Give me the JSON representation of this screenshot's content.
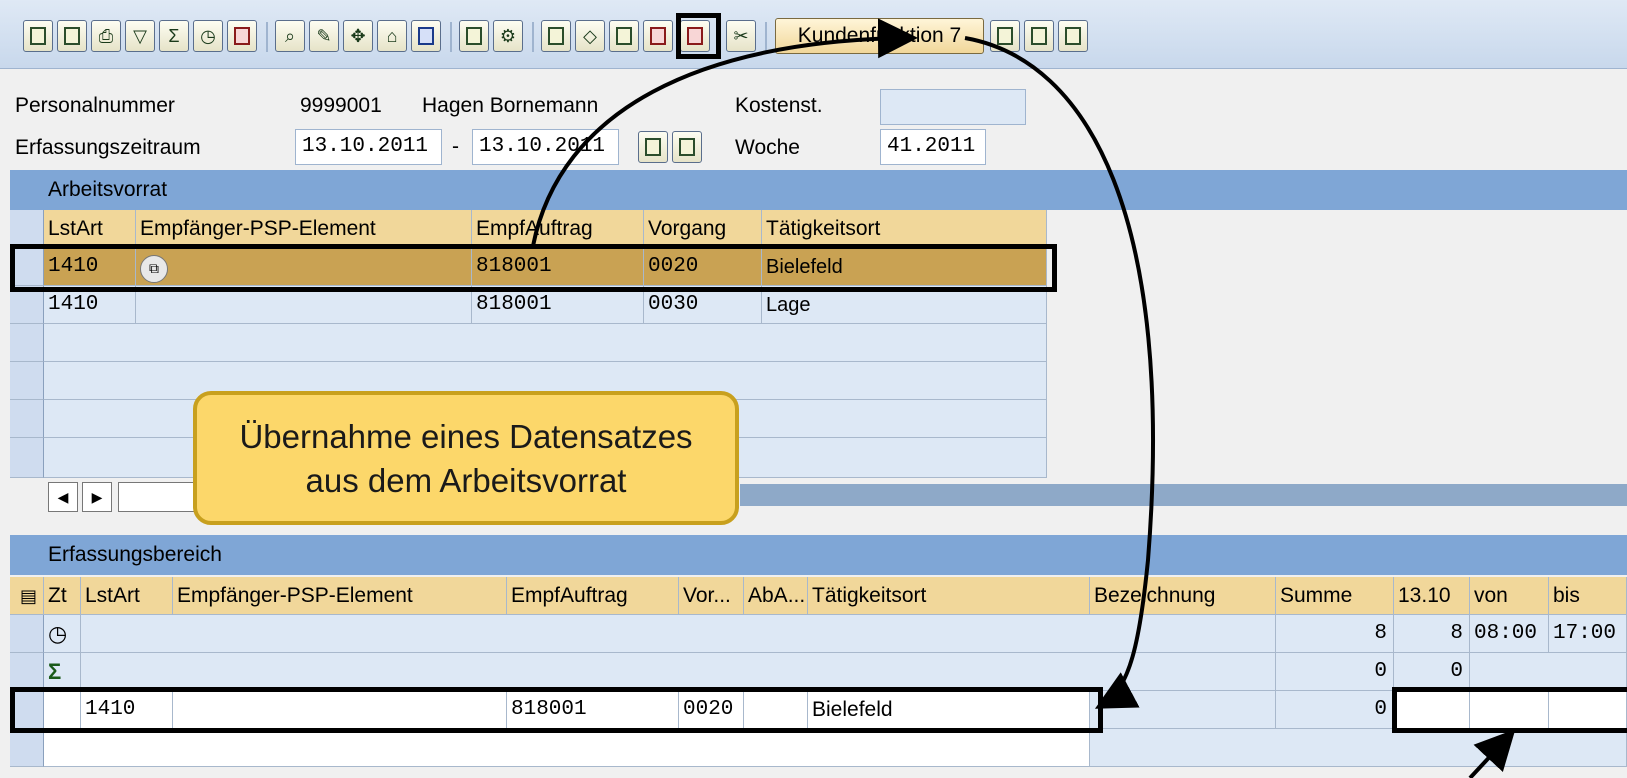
{
  "toolbar": {
    "customer_button": "Kundenfunktion 7"
  },
  "header": {
    "personal_label": "Personalnummer",
    "personal_value": "9999001",
    "personal_name": "Hagen Bornemann",
    "kostenst_label": "Kostenst.",
    "kostenst_value": "",
    "zeitraum_label": "Erfassungszeitraum",
    "zeitraum_from": "13.10.2011",
    "zeitraum_sep": "-",
    "zeitraum_to": "13.10.2011",
    "woche_label": "Woche",
    "woche_value": "41.2011"
  },
  "arbeitsvorrat": {
    "title": "Arbeitsvorrat",
    "columns": [
      "LstArt",
      "Empfänger-PSP-Element",
      "EmpfAuftrag",
      "Vorgang",
      "Tätigkeitsort"
    ],
    "rows": [
      [
        "1410",
        "",
        "818001",
        "0020",
        "Bielefeld"
      ],
      [
        "1410",
        "",
        "818001",
        "0030",
        "Lage"
      ]
    ]
  },
  "callout": {
    "line1": "Übernahme eines Datensatzes",
    "line2": "aus dem Arbeitsvorrat"
  },
  "erfassung": {
    "title": "Erfassungsbereich",
    "columns": [
      "Zt",
      "LstArt",
      "Empfänger-PSP-Element",
      "EmpfAuftrag",
      "Vor...",
      "AbA...",
      "Tätigkeitsort",
      "Bezeichnung",
      "Summe",
      "13.10",
      "von",
      "bis"
    ],
    "row_clock": {
      "summe": "8",
      "day": "8",
      "von": "08:00",
      "bis": "17:00"
    },
    "row_sigma": {
      "summe": "0",
      "day": "0"
    },
    "row_new": {
      "lstart": "1410",
      "auftrag": "818001",
      "vorgang": "0020",
      "ort": "Bielefeld",
      "summe": "0"
    }
  }
}
